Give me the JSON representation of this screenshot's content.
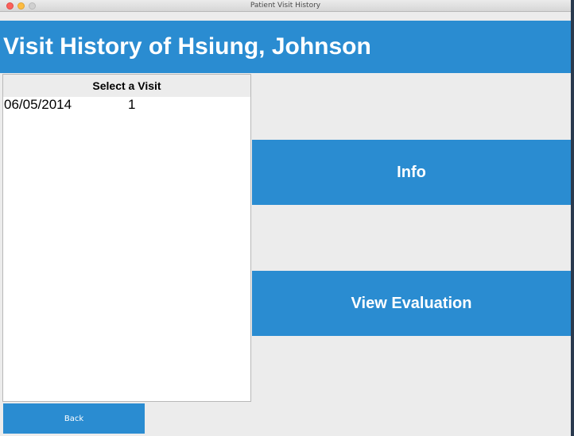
{
  "window": {
    "title": "Patient Visit History"
  },
  "header": {
    "title": "Visit History of Hsiung, Johnson"
  },
  "visit_list": {
    "heading": "Select a Visit",
    "rows": [
      {
        "date": "06/05/2014",
        "number": "1"
      }
    ]
  },
  "buttons": {
    "info": "Info",
    "view_evaluation": "View Evaluation",
    "back": "Back"
  },
  "colors": {
    "accent": "#2a8cd1",
    "background": "#ececec"
  }
}
